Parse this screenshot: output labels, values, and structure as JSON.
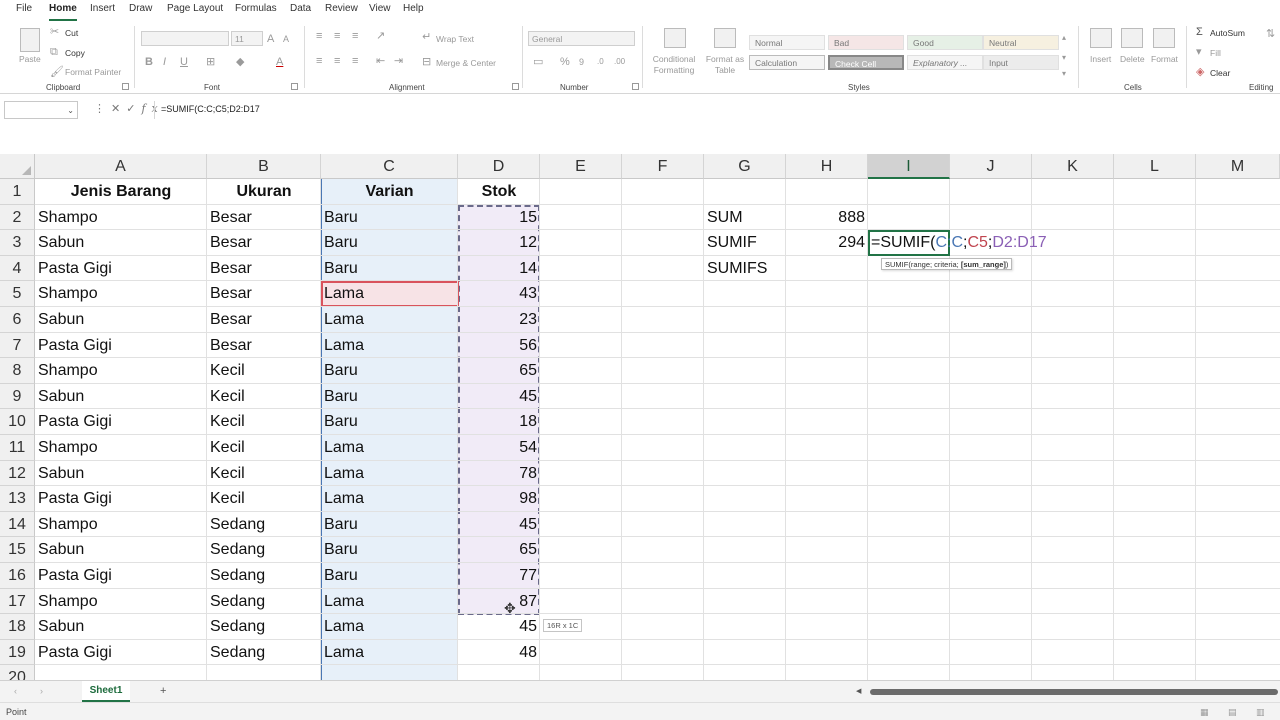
{
  "menu": [
    "File",
    "Home",
    "Insert",
    "Draw",
    "Page Layout",
    "Formulas",
    "Data",
    "Review",
    "View",
    "Help"
  ],
  "ribbon": {
    "clipboard": {
      "paste": "Paste",
      "cut": "Cut",
      "copy": "Copy",
      "format_painter": "Format Painter",
      "label": "Clipboard"
    },
    "font": {
      "size": "11",
      "label": "Font"
    },
    "alignment": {
      "wrap": "Wrap Text",
      "merge": "Merge & Center",
      "label": "Alignment"
    },
    "number": {
      "format": "General",
      "label": "Number"
    },
    "styles": {
      "conditional": "Conditional Formatting",
      "format_table": "Format as Table",
      "cells": [
        "Normal",
        "Bad",
        "Good",
        "Neutral",
        "Calculation",
        "Check Cell",
        "Explanatory ...",
        "Input"
      ],
      "label": "Styles"
    },
    "cells": {
      "insert": "Insert",
      "delete": "Delete",
      "format": "Format",
      "label": "Cells"
    },
    "editing": {
      "autosum": "AutoSum",
      "fill": "Fill",
      "clear": "Clear",
      "label": "Editing"
    }
  },
  "formula_bar": {
    "name_box": "",
    "formula": "=SUMIF(C:C;C5;D2:D17"
  },
  "columns": [
    "A",
    "B",
    "C",
    "D",
    "E",
    "F",
    "G",
    "H",
    "I",
    "J",
    "K",
    "L",
    "M"
  ],
  "rows": [
    "1",
    "2",
    "3",
    "4",
    "5",
    "6",
    "7",
    "8",
    "9",
    "10",
    "11",
    "12",
    "13",
    "14",
    "15",
    "16",
    "17",
    "18",
    "19",
    "20"
  ],
  "headers": {
    "a": "Jenis Barang",
    "b": "Ukuran",
    "c": "Varian",
    "d": "Stok"
  },
  "table": [
    [
      "Shampo",
      "Besar",
      "Baru",
      "15"
    ],
    [
      "Sabun",
      "Besar",
      "Baru",
      "12"
    ],
    [
      "Pasta Gigi",
      "Besar",
      "Baru",
      "14"
    ],
    [
      "Shampo",
      "Besar",
      "Lama",
      "43"
    ],
    [
      "Sabun",
      "Besar",
      "Lama",
      "23"
    ],
    [
      "Pasta Gigi",
      "Besar",
      "Lama",
      "56"
    ],
    [
      "Shampo",
      "Kecil",
      "Baru",
      "65"
    ],
    [
      "Sabun",
      "Kecil",
      "Baru",
      "45"
    ],
    [
      "Pasta Gigi",
      "Kecil",
      "Baru",
      "18"
    ],
    [
      "Shampo",
      "Kecil",
      "Lama",
      "54"
    ],
    [
      "Sabun",
      "Kecil",
      "Lama",
      "78"
    ],
    [
      "Pasta Gigi",
      "Kecil",
      "Lama",
      "98"
    ],
    [
      "Shampo",
      "Sedang",
      "Baru",
      "45"
    ],
    [
      "Sabun",
      "Sedang",
      "Baru",
      "65"
    ],
    [
      "Pasta Gigi",
      "Sedang",
      "Baru",
      "77"
    ],
    [
      "Shampo",
      "Sedang",
      "Lama",
      "87"
    ],
    [
      "Sabun",
      "Sedang",
      "Lama",
      "45"
    ],
    [
      "Pasta Gigi",
      "Sedang",
      "Lama",
      "48"
    ]
  ],
  "summary": {
    "sum_label": "SUM",
    "sum_value": "888",
    "sumif_label": "SUMIF",
    "sumif_value": "294",
    "sumifs_label": "SUMIFS"
  },
  "edit_formula": {
    "p1": "=SUMIF(",
    "p2": "C:C",
    "p3": ";",
    "p4": "C5",
    "p5": ";",
    "p6": "D2:D17"
  },
  "tooltip": {
    "pre": "SUMIF(range; criteria; ",
    "bold": "[sum_range]",
    "post": ")"
  },
  "range_tip": "16R x 1C",
  "sheet_tab": "Sheet1",
  "add_sheet": "+",
  "status": "Point",
  "colors": {
    "accent": "#217346",
    "ref_blue": "#4a77b4",
    "ref_red": "#d9535c",
    "ref_purple": "#8a5fb5"
  }
}
